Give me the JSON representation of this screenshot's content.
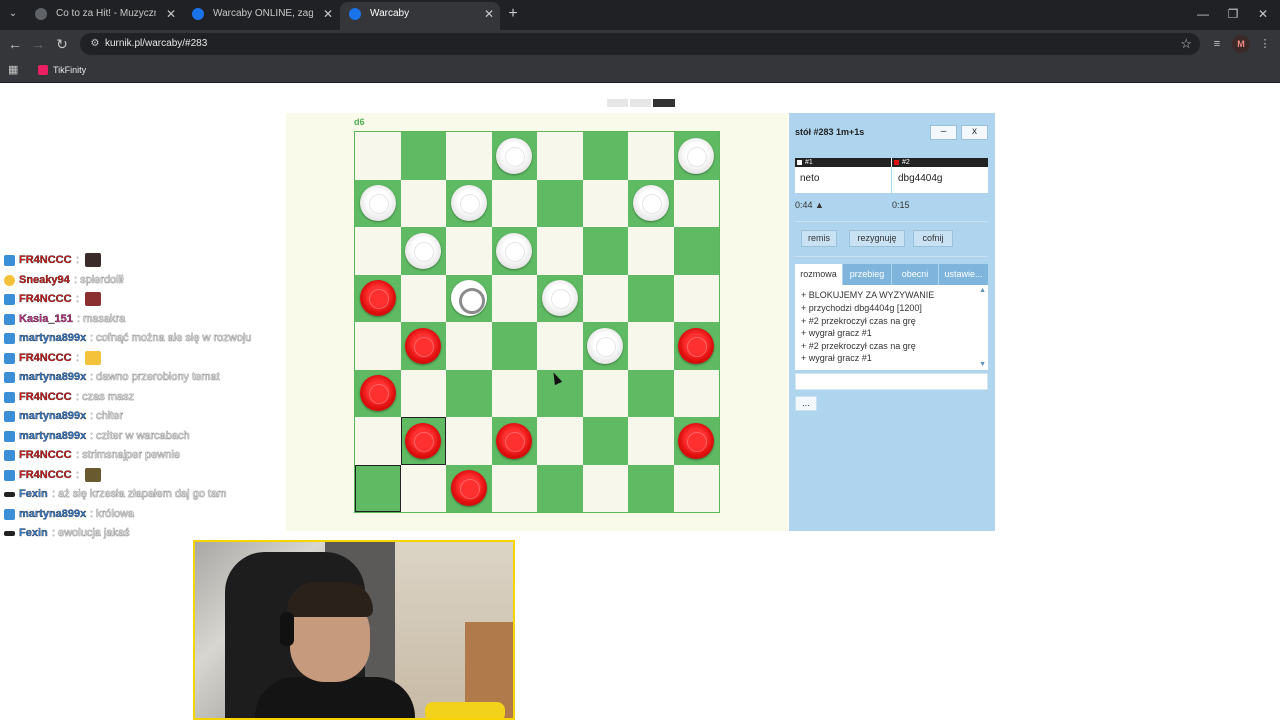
{
  "browser": {
    "tabs": [
      {
        "label": "Co to za Hit! - Muzyczny Quiz H",
        "active": false,
        "favicon_color": "#5f6368"
      },
      {
        "label": "Warcaby ONLINE, zagraj - Kurni",
        "active": false,
        "favicon_color": "#1a73e8"
      },
      {
        "label": "Warcaby",
        "active": true,
        "favicon_color": "#1a73e8"
      }
    ],
    "url": "kurnik.pl/warcaby/#283",
    "bookmark": "TikFinity",
    "profile_initial": "M"
  },
  "game": {
    "last_move_label": "d6",
    "board": [
      [
        "",
        "",
        "",
        "w",
        "",
        "",
        "",
        "w"
      ],
      [
        "w",
        "",
        "w",
        "",
        "",
        "",
        "w",
        ""
      ],
      [
        "",
        "w",
        "",
        "w",
        "",
        "",
        "",
        ""
      ],
      [
        "r",
        "",
        "o",
        "",
        "w",
        "",
        "",
        ""
      ],
      [
        "",
        "r",
        "",
        "",
        "",
        "w",
        "",
        "r"
      ],
      [
        "r",
        "",
        "",
        "",
        "",
        "",
        "",
        ""
      ],
      [
        "",
        "r",
        "",
        "r",
        "",
        "",
        "",
        "r"
      ],
      [
        "",
        "",
        "r",
        "",
        "",
        "",
        "",
        ""
      ]
    ],
    "highlighted_squares": [
      [
        6,
        1
      ],
      [
        7,
        0
      ]
    ],
    "colors": {
      "dark_square": "#5fba63",
      "light_square": "#f7f7ec",
      "red_piece": "#e01010",
      "white_piece": "#ffffff"
    }
  },
  "panel": {
    "table_title": "stół #283  1m+1s",
    "minimize_label": "–",
    "close_label": "x",
    "player1": {
      "seat": "#1",
      "name": "neto",
      "time": "0:44 ▲",
      "seat_color": "#ffffff"
    },
    "player2": {
      "seat": "#2",
      "name": "dbg4404g",
      "time": "0:15",
      "seat_color": "#e01010"
    },
    "actions": {
      "draw": "remis",
      "resign": "rezygnuję",
      "undo": "cofnij"
    },
    "tabs": [
      "rozmowa",
      "przebieg",
      "obecni",
      "ustawie..."
    ],
    "chat": [
      "+ BLOKUJEMY ZA WYZYWANIE",
      "+ przychodzi dbg4404g [1200]",
      "+ #2 przekroczył czas na grę",
      "+ wygrał gracz #1",
      "+ #2 przekroczył czas na grę",
      "+ wygrał gracz #1"
    ],
    "more_label": "..."
  },
  "stream_chat": [
    {
      "icon": "mod",
      "name": "FR4NCCC",
      "name_color": "red",
      "text": ":",
      "image": "#3a2a2a"
    },
    {
      "icon": "emoji",
      "name": "Sneaky94",
      "name_color": "red",
      "text": ": spierdolił",
      "image": ""
    },
    {
      "icon": "mod",
      "name": "FR4NCCC",
      "name_color": "red",
      "text": ":",
      "image": "#8a3030"
    },
    {
      "icon": "mod",
      "name": "Kasia_151",
      "name_color": "pink",
      "text": ": masakra",
      "image": ""
    },
    {
      "icon": "mod",
      "name": "martyna899x",
      "name_color": "blue",
      "text": ": cofnąć można ale się w rozwoju",
      "image": ""
    },
    {
      "icon": "mod",
      "name": "FR4NCCC",
      "name_color": "red",
      "text": ":",
      "image": "#f5c33b"
    },
    {
      "icon": "mod",
      "name": "martyna899x",
      "name_color": "blue",
      "text": ": dawno przerobiony temat",
      "image": ""
    },
    {
      "icon": "mod",
      "name": "FR4NCCC",
      "name_color": "red",
      "text": ": czas masz",
      "image": ""
    },
    {
      "icon": "mod",
      "name": "martyna899x",
      "name_color": "blue",
      "text": ": chiter",
      "image": ""
    },
    {
      "icon": "mod",
      "name": "martyna899x",
      "name_color": "blue",
      "text": ": cziter w warcabach",
      "image": ""
    },
    {
      "icon": "mod",
      "name": "FR4NCCC",
      "name_color": "red",
      "text": ": strimsnajper pewnie",
      "image": ""
    },
    {
      "icon": "mod",
      "name": "FR4NCCC",
      "name_color": "red",
      "text": ":",
      "image": "#6a5a30"
    },
    {
      "icon": "glasses",
      "name": "Fexin",
      "name_color": "blue",
      "text": ": aż się krzesła złapałem daj go tam",
      "image": ""
    },
    {
      "icon": "mod",
      "name": "martyna899x",
      "name_color": "blue",
      "text": ": królowa",
      "image": ""
    },
    {
      "icon": "glasses",
      "name": "Fexin",
      "name_color": "blue",
      "text": ": ewolucja jakaś",
      "image": ""
    }
  ]
}
